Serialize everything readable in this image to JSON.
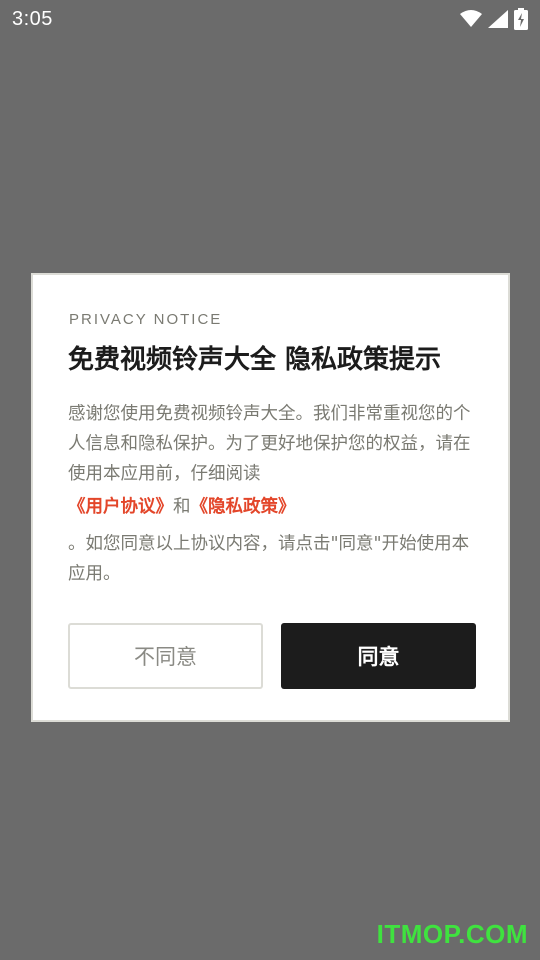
{
  "status_bar": {
    "time": "3:05",
    "icons": [
      "wifi-icon",
      "signal-icon",
      "battery-icon"
    ]
  },
  "dialog": {
    "eyebrow": "PRIVACY NOTICE",
    "title": "免费视频铃声大全 隐私政策提示",
    "body_part1": "感谢您使用免费视频铃声大全。我们非常重视您的个人信息和隐私保护。为了更好地保护您的权益，请在使用本应用前，仔细阅读",
    "link_user_agreement": "《用户协议》",
    "link_and": "和",
    "link_privacy_policy": "《隐私政策》",
    "body_part2": "。如您同意以上协议内容，请点击\"同意\"开始使用本应用。",
    "decline_label": "不同意",
    "agree_label": "同意"
  },
  "watermark": "ITMOP.COM",
  "colors": {
    "overlay": "#6b6b6b",
    "link": "#e3462a",
    "primary_button": "#1c1c1c",
    "watermark": "#3fe23f"
  }
}
